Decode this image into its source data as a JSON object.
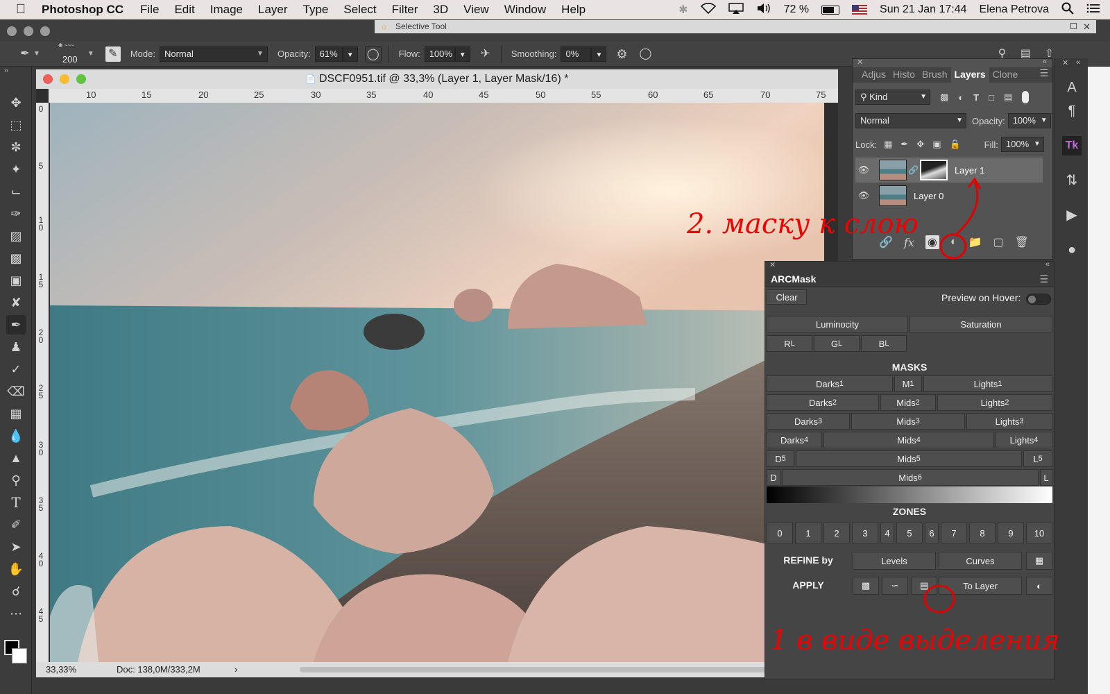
{
  "menubar": {
    "app": "Photoshop CC",
    "items": [
      "File",
      "Edit",
      "Image",
      "Layer",
      "Type",
      "Select",
      "Filter",
      "3D",
      "View",
      "Window",
      "Help"
    ],
    "battery": "72 %",
    "datetime": "Sun 21 Jan  17:44",
    "user": "Elena Petrova"
  },
  "selective_tool": {
    "title": "Selective Tool"
  },
  "options": {
    "brush_size": "200",
    "mode_label": "Mode:",
    "mode_value": "Normal",
    "opacity_label": "Opacity:",
    "opacity_value": "61%",
    "flow_label": "Flow:",
    "flow_value": "100%",
    "smoothing_label": "Smoothing:",
    "smoothing_value": "0%"
  },
  "document": {
    "title": "DSCF0951.tif @ 33,3% (Layer 1, Layer Mask/16) *",
    "ruler_h": [
      "10",
      "15",
      "20",
      "25",
      "30",
      "35",
      "40",
      "45",
      "50",
      "55",
      "60",
      "65",
      "70",
      "75"
    ],
    "ruler_v": [
      "0",
      "5",
      "1 0",
      "1 5",
      "2 0",
      "2 5",
      "3 0",
      "3 5",
      "4 0",
      "4 5"
    ],
    "zoom": "33,33%",
    "doc_size": "Doc: 138,0M/333,2M"
  },
  "layers_panel": {
    "tabs": [
      "Adjus",
      "Histo",
      "Brush",
      "Layers",
      "Clone"
    ],
    "active_tab": "Layers",
    "kind_label": "Kind",
    "blend": "Normal",
    "opacity_label": "Opacity:",
    "opacity_value": "100%",
    "lock_label": "Lock:",
    "fill_label": "Fill:",
    "fill_value": "100%",
    "layers": [
      {
        "name": "Layer 1",
        "has_mask": true,
        "selected": true
      },
      {
        "name": "Layer 0",
        "has_mask": false,
        "selected": false
      }
    ]
  },
  "arcmask": {
    "title": "ARCMask",
    "clear": "Clear",
    "preview_label": "Preview on Hover:",
    "luminocity": "Luminocity",
    "saturation": "Saturation",
    "channels": [
      "R",
      "G",
      "B"
    ],
    "channel_sub": "L",
    "masks_label": "MASKS",
    "rows": [
      [
        "Darks",
        "1",
        "M",
        "1",
        "Lights",
        "1"
      ],
      [
        "Darks",
        "2",
        "Mids",
        "2",
        "Lights",
        "2"
      ],
      [
        "Darks",
        "3",
        "Mids",
        "3",
        "Lights",
        "3"
      ],
      [
        "Darks",
        "4",
        "Mids",
        "4",
        "Lights",
        "4"
      ],
      [
        "D",
        "5",
        "Mids",
        "5",
        "L",
        "5"
      ],
      [
        "D",
        "",
        "Mids",
        "6",
        "L",
        ""
      ]
    ],
    "zones_label": "ZONES",
    "zones": [
      "0",
      "1",
      "2",
      "3",
      "4",
      "5",
      "6",
      "7",
      "8",
      "9",
      "10"
    ],
    "refine_label": "REFINE by",
    "levels": "Levels",
    "curves": "Curves",
    "apply_label": "APPLY",
    "to_layer": "To Layer"
  },
  "annotations": {
    "note1": "1 в виде выделения",
    "note2": "2. маску к слою"
  },
  "colors": {
    "annotation": "#e00000",
    "panel_bg": "#535353",
    "accent_close": "#ed5f57",
    "accent_min": "#f5bd2f",
    "accent_max": "#60c441"
  }
}
